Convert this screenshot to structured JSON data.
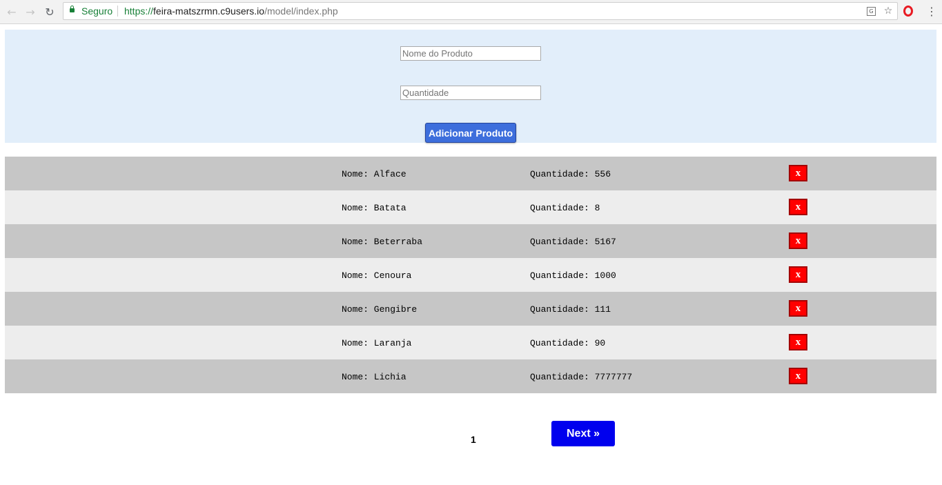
{
  "browser": {
    "security_label": "Seguro",
    "url_scheme": "https://",
    "url_host": "feira-matszrmn.c9users.io",
    "url_path": "/model/index.php",
    "icons": [
      "back-arrow-icon",
      "forward-arrow-icon",
      "reload-icon",
      "lock-icon",
      "translate-icon",
      "bookmark-star-icon",
      "opera-icon",
      "kebab-menu-icon"
    ]
  },
  "form": {
    "name_placeholder": "Nome do Produto",
    "quantity_placeholder": "Quantidade",
    "submit_label": "Adicionar Produto"
  },
  "products": [
    {
      "name": "Nome: Alface",
      "quantity": "Quantidade: 556",
      "delete_label": "x"
    },
    {
      "name": "Nome: Batata",
      "quantity": "Quantidade: 8",
      "delete_label": "x"
    },
    {
      "name": "Nome: Beterraba",
      "quantity": "Quantidade: 5167",
      "delete_label": "x"
    },
    {
      "name": "Nome: Cenoura",
      "quantity": "Quantidade: 1000",
      "delete_label": "x"
    },
    {
      "name": "Nome: Gengibre",
      "quantity": "Quantidade: 111",
      "delete_label": "x"
    },
    {
      "name": "Nome: Laranja",
      "quantity": "Quantidade: 90",
      "delete_label": "x"
    },
    {
      "name": "Nome: Lichia",
      "quantity": "Quantidade: 7777777",
      "delete_label": "x"
    }
  ],
  "pagination": {
    "current_page": "1",
    "next_label": "Next »"
  },
  "colors": {
    "form_background": "#e2eefa",
    "add_button": "#3d6edc",
    "row_dark": "#c6c6c6",
    "row_light": "#ededed",
    "delete_button": "#ff0000",
    "next_button": "#0000ee",
    "secure_green": "#188038"
  }
}
